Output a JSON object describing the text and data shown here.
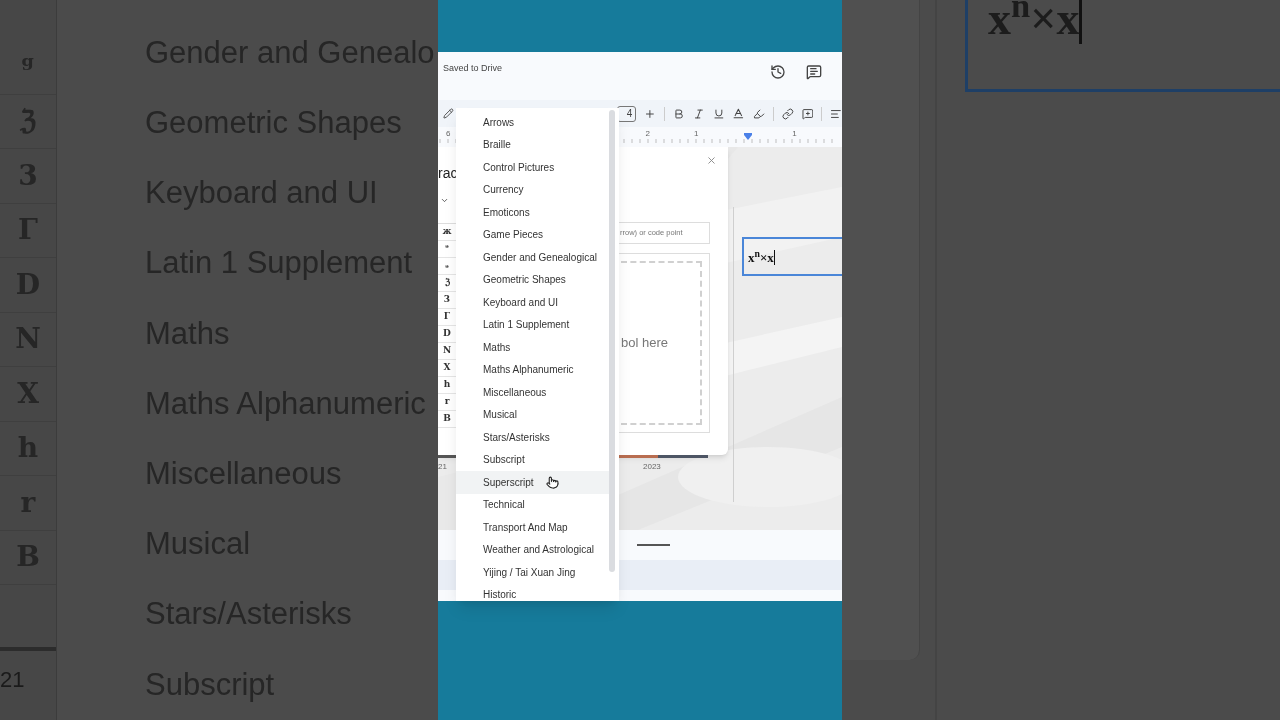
{
  "background_left": {
    "glyphs": [
      "ᵍ",
      "ℨ",
      "3",
      "Γ",
      "D",
      "N",
      "X",
      "h",
      "r",
      "B"
    ],
    "categories": [
      "Gender and Genealo",
      "Geometric Shapes",
      "Keyboard and UI",
      "Latin 1 Supplement",
      "Maths",
      "Maths Alphanumeric",
      "Miscellaneous",
      "Musical",
      "Stars/Asterisks",
      "Subscript"
    ],
    "year": "21"
  },
  "background_right": {
    "equation": "x$^{n}$×x"
  },
  "doc": {
    "save_status": "Saved to Drive",
    "font_size": "4",
    "ruler_numbers": [
      "6",
      "2",
      "1",
      "1"
    ],
    "dialog": {
      "title": "rac",
      "glyphs": [
        "ж",
        "ᵊ",
        "ₔ",
        "ℨ",
        "3",
        "Γ",
        "D",
        "N",
        "X",
        "h",
        "r",
        "B"
      ],
      "search_placeholder": "rrow) or code point",
      "draw_hint": "bol here"
    },
    "year_labels": [
      "21",
      "2023"
    ],
    "equation": "x$^{n}$×x"
  },
  "menu": {
    "items": [
      {
        "label": "Arrows",
        "selected": false
      },
      {
        "label": "Braille",
        "selected": false
      },
      {
        "label": "Control Pictures",
        "selected": false
      },
      {
        "label": "Currency",
        "selected": false
      },
      {
        "label": "Emoticons",
        "selected": false
      },
      {
        "label": "Game Pieces",
        "selected": false
      },
      {
        "label": "Gender and Genealogical",
        "selected": false
      },
      {
        "label": "Geometric Shapes",
        "selected": false
      },
      {
        "label": "Keyboard and UI",
        "selected": false
      },
      {
        "label": "Latin 1 Supplement",
        "selected": false
      },
      {
        "label": "Maths",
        "selected": false
      },
      {
        "label": "Maths Alphanumeric",
        "selected": false
      },
      {
        "label": "Miscellaneous",
        "selected": false
      },
      {
        "label": "Musical",
        "selected": false
      },
      {
        "label": "Stars/Asterisks",
        "selected": false
      },
      {
        "label": "Subscript",
        "selected": false
      },
      {
        "label": "Superscript",
        "selected": true
      },
      {
        "label": "Technical",
        "selected": false
      },
      {
        "label": "Transport And Map",
        "selected": false
      },
      {
        "label": "Weather and Astrological",
        "selected": false
      },
      {
        "label": "Yijing / Tai Xuan Jing",
        "selected": false
      },
      {
        "label": "Historic",
        "selected": false
      }
    ]
  }
}
